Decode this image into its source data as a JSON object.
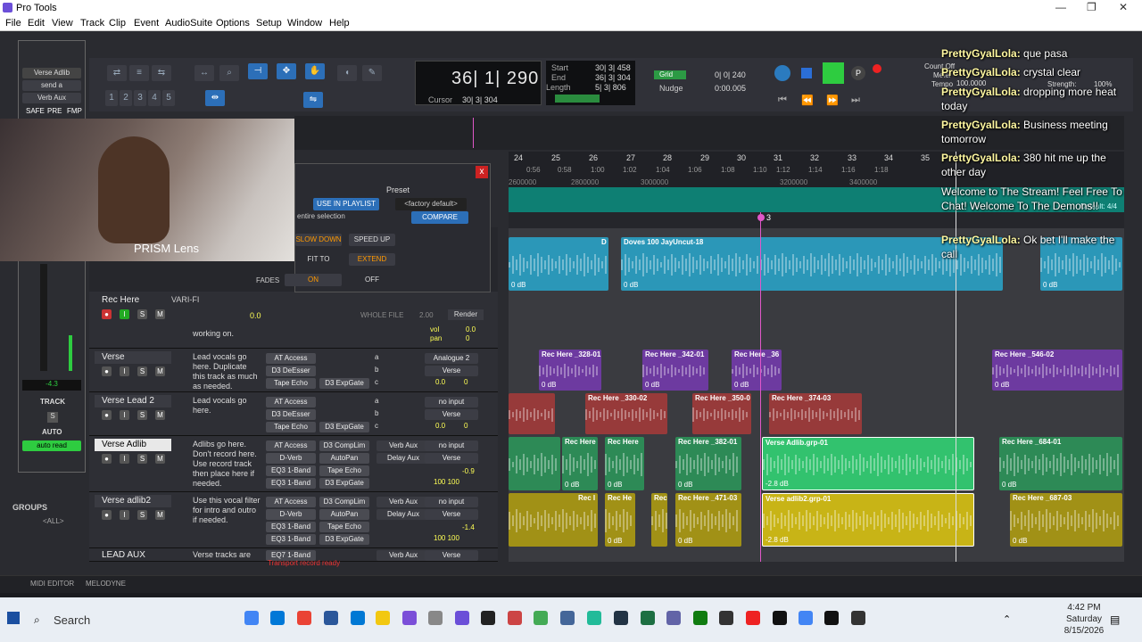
{
  "app": {
    "title": "Pro Tools"
  },
  "window_controls": {
    "minimize": "—",
    "maximize": "❐",
    "close": "✕"
  },
  "menu": [
    "File",
    "Edit",
    "View",
    "Track",
    "Clip",
    "Event",
    "AudioSuite",
    "Options",
    "Setup",
    "Window",
    "Help"
  ],
  "counter": {
    "main": "36| 1| 290",
    "cursor_label": "Cursor",
    "cursor_value": "30| 3| 304"
  },
  "selection": {
    "start_label": "Start",
    "end_label": "End",
    "length_label": "Length",
    "start": "30| 3| 458",
    "end": "36| 3| 304",
    "length": "5| 3| 806"
  },
  "grid": {
    "grid_label": "Grid",
    "grid_value": "0| 0| 240",
    "nudge_label": "Nudge",
    "nudge_value": "0:00.005"
  },
  "counter_off": {
    "count_off": "Count Off",
    "meter": "Meter",
    "tempo": "Tempo",
    "tempo_value": "100.0000"
  },
  "strength": {
    "label": "Strength:",
    "value": "100%"
  },
  "ruler": {
    "bars": [
      "24",
      "25",
      "26",
      "27",
      "28",
      "29",
      "30",
      "31",
      "32",
      "33",
      "34",
      "35"
    ],
    "timecodes": [
      "0:56",
      "0:58",
      "1:00",
      "1:02",
      "1:04",
      "1:06",
      "1:08",
      "1:10",
      "1:12",
      "1:14",
      "1:16",
      "1:18"
    ],
    "samples": [
      "2600000",
      "2800000",
      "3000000",
      "3200000",
      "3400000"
    ]
  },
  "tempo_ruler": {
    "default": "Default: 4/4"
  },
  "marker": {
    "label": "3"
  },
  "popup": {
    "preset_label": "Preset",
    "use_in_playlist": "USE IN PLAYLIST",
    "factory": "<factory default>",
    "entire_selection": "entire selection",
    "compare": "COMPARE",
    "slow_down": "SLOW DOWN",
    "speed_up": "SPEED UP",
    "fit_to": "FIT TO",
    "extend": "EXTEND",
    "fades": "FADES",
    "on": "ON",
    "off": "OFF",
    "close": "x"
  },
  "rec_here": {
    "name": "Rec Here",
    "varifi": "VARI-FI",
    "value": "0.0",
    "whole_file": "WHOLE FILE",
    "whole_value": "2.00",
    "render": "Render",
    "comment": "working on.",
    "vol": "vol",
    "vol_value": "0.0",
    "pan": "pan",
    "pan_value": "0"
  },
  "tracks": [
    {
      "name": "Verse",
      "comment": "Lead vocals go here. Duplicate this track as much as needed.",
      "inserts": [
        "AT Access",
        "D3 DeEsser",
        "Tape Echo"
      ],
      "inserts2": [
        "",
        "",
        "D3 ExpGate"
      ],
      "sends": [
        "a",
        "b",
        "c"
      ],
      "io_out": "Analogue 2",
      "io_bus": "Verse",
      "vol": "0.0",
      "pan": "0"
    },
    {
      "name": "Verse Lead 2",
      "comment": "Lead vocals go here.",
      "inserts": [
        "AT Access",
        "D3 DeEsser",
        "Tape Echo"
      ],
      "inserts2": [
        "",
        "",
        "D3 ExpGate"
      ],
      "sends": [
        "a",
        "b",
        "c"
      ],
      "io_out": "no input",
      "io_bus": "Verse",
      "vol": "0.0",
      "pan": "0"
    },
    {
      "name": "Verse Adlib",
      "comment": "Adlibs go here. Don't record here. Use record track then place here if needed.",
      "inserts": [
        "AT Access",
        "D-Verb",
        "EQ3 1-Band",
        "EQ3 1-Band"
      ],
      "inserts2": [
        "D3 CompLim",
        "AutoPan",
        "Tape Echo",
        "D3 ExpGate"
      ],
      "sends": [
        "Verb Aux",
        "Delay Aux",
        "c",
        "d"
      ],
      "io_out": "no input",
      "io_bus": "Verse",
      "vol": "-0.9",
      "pan": "100 100"
    },
    {
      "name": "Verse adlib2",
      "comment": "Use this vocal filter for intro and outro if needed.",
      "inserts": [
        "AT Access",
        "D-Verb",
        "EQ3 1-Band",
        "EQ3 1-Band"
      ],
      "inserts2": [
        "D3 CompLim",
        "AutoPan",
        "Tape Echo",
        "D3 ExpGate"
      ],
      "sends": [
        "Verb Aux",
        "Delay Aux",
        "c",
        "d"
      ],
      "io_out": "no input",
      "io_bus": "Verse",
      "vol": "-1.4",
      "pan": "100 100"
    },
    {
      "name": "LEAD AUX",
      "comment": "Verse tracks are",
      "inserts": [
        "EQ7 1-Band"
      ],
      "inserts2": [
        ""
      ],
      "sends": [
        "Verb Aux"
      ],
      "io_out": "Verse",
      "io_bus": "",
      "vol": "",
      "pan": ""
    }
  ],
  "status": {
    "transport": "Transport record ready"
  },
  "clips": {
    "top": [
      {
        "name": "D",
        "db": "0 dB"
      },
      {
        "name": "Doves 100 JayUncut-18",
        "db": "0 dB"
      },
      {
        "name": "",
        "db": "0 dB"
      }
    ],
    "verse": [
      {
        "name": "Rec Here _328-01",
        "db": "0 dB"
      },
      {
        "name": "Rec Here _342-01",
        "db": "0 dB"
      },
      {
        "name": "Rec Here _36",
        "db": "0 dB"
      },
      {
        "name": "Rec Here _546-02",
        "db": "0 dB"
      }
    ],
    "verse2": [
      {
        "name": "",
        "db": ""
      },
      {
        "name": "Rec Here _330-02",
        "db": ""
      },
      {
        "name": "Rec Here _350-0",
        "db": ""
      },
      {
        "name": "Rec Here _374-03",
        "db": ""
      }
    ],
    "adlib": [
      {
        "name": "",
        "db": ""
      },
      {
        "name": "Rec Here",
        "db": "0 dB"
      },
      {
        "name": "Rec Here",
        "db": "0 dB"
      },
      {
        "name": "Rec Here _382-01",
        "db": "0 dB"
      },
      {
        "name": "Verse Adlib.grp-01",
        "db": "-2.8 dB"
      },
      {
        "name": "Rec Here _684-01",
        "db": "0 dB"
      }
    ],
    "adlib2": [
      {
        "name": "Rec I",
        "db": ""
      },
      {
        "name": "Rec He",
        "db": "0 dB"
      },
      {
        "name": "Rec",
        "db": ""
      },
      {
        "name": "Rec Here _471-03",
        "db": "0 dB"
      },
      {
        "name": "Verse adlib2.grp-01",
        "db": "-2.8 dB"
      },
      {
        "name": "Rec Here _687-03",
        "db": "0 dB"
      }
    ]
  },
  "leftmix": {
    "insert": "Verse Adlib",
    "send_a": "send a",
    "aux": "Verb Aux",
    "safe": "SAFE",
    "pre": "PRE",
    "fmp": "FMP",
    "value": "-4.3",
    "track": "TRACK",
    "s": "S",
    "auto": "AUTO",
    "auto_read": "auto read"
  },
  "webcam": {
    "label": "PRISM Lens"
  },
  "groups": {
    "label": "GROUPS",
    "all": "<ALL>"
  },
  "chat": [
    {
      "user": "PrettyGyalLola:",
      "msg": " que pasa"
    },
    {
      "user": "PrettyGyalLola:",
      "msg": " crystal clear"
    },
    {
      "user": "PrettyGyalLola:",
      "msg": " dropping more heat today"
    },
    {
      "user": "PrettyGyalLola:",
      "msg": " Business meeting tomorrow"
    },
    {
      "user": "PrettyGyalLola:",
      "msg": " 380 hit me up the other day"
    },
    {
      "user": "",
      "msg": "Welcome to The Stream! Feel Free To Chat! Welcome To The Demons!!"
    },
    {
      "user": "PrettyGyalLola:",
      "msg": " Ok bet I'll make the call"
    }
  ],
  "bottom": {
    "midi_editor": "MIDI EDITOR",
    "melodyne": "MELODYNE"
  },
  "taskbar": {
    "search": "Search",
    "time": "4:42 PM",
    "day": "Saturday",
    "date": "8/15/2026"
  },
  "colors": {
    "accent": "#2c6fb8",
    "play": "#2ecc40",
    "tempo_ruler": "#0e7f73"
  }
}
